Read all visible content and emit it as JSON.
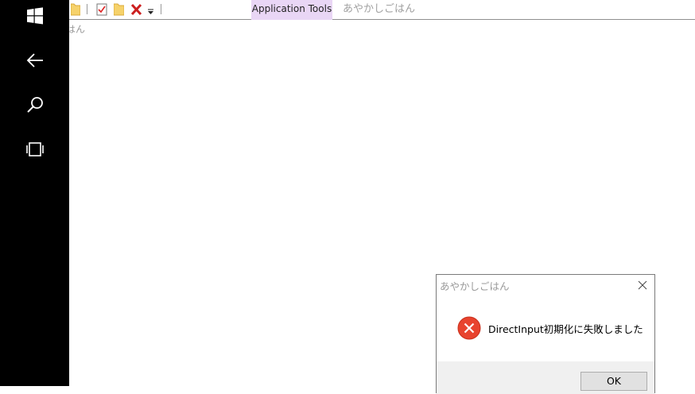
{
  "taskbar": {
    "items": [
      {
        "icon": "windows-logo-icon"
      },
      {
        "icon": "back-arrow-icon"
      },
      {
        "icon": "search-icon"
      },
      {
        "icon": "task-view-icon"
      }
    ]
  },
  "toolbar": {
    "context_tab_label": "Application Tools",
    "window_title": "あやかしごはん",
    "clipped_label": "はん",
    "icons": [
      "folder-icon",
      "properties-icon",
      "new-folder-icon",
      "delete-icon",
      "customize-dropdown-icon"
    ]
  },
  "dialog": {
    "title": "あやかしごはん",
    "message": "DirectInput初期化に失敗しました",
    "ok_label": "OK",
    "icon": "error-icon",
    "colors": {
      "error": "#e8432e"
    }
  }
}
